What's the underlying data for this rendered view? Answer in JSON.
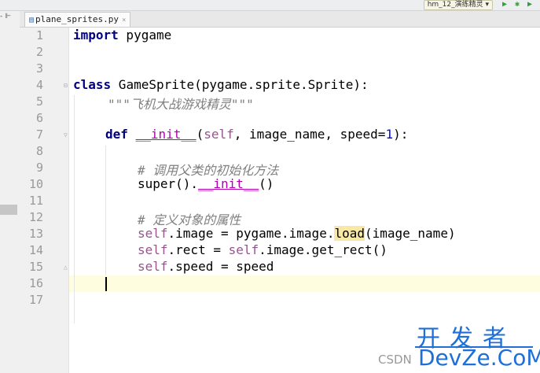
{
  "toolbar": {
    "run_config": "hm_12_演练精灵 ▾"
  },
  "tab": {
    "filename": "plane_sprites.py",
    "close": "×"
  },
  "left_strip": {
    "mini": "- ⊩"
  },
  "line_numbers": [
    "1",
    "2",
    "3",
    "4",
    "5",
    "6",
    "7",
    "8",
    "9",
    "10",
    "11",
    "12",
    "13",
    "14",
    "15",
    "16",
    "17"
  ],
  "code": {
    "l1_kw": "import",
    "l1_rest": " pygame",
    "l4_kw": "class",
    "l4_rest": " GameSprite(pygame.sprite.Sprite):",
    "l5_doc": "\"\"\"飞机大战游戏精灵\"\"\"",
    "l7_kw": "def",
    "l7_sp": " ",
    "l7_init": "__init__",
    "l7_a": "(",
    "l7_self": "self",
    "l7_b": ", image_name, speed=",
    "l7_num": "1",
    "l7_c": "):",
    "l9_comment": "# 调用父类的初始化方法",
    "l10_a": "super().",
    "l10_init": "__init__",
    "l10_b": "()",
    "l12_comment": "# 定义对象的属性",
    "l13_self": "self",
    "l13_a": ".image = pygame.image.",
    "l13_load": "load",
    "l13_b": "(image_name)",
    "l14_self1": "self",
    "l14_a": ".rect = ",
    "l14_self2": "self",
    "l14_b": ".image.get_rect()",
    "l15_self": "self",
    "l15_a": ".speed = speed"
  },
  "watermark": {
    "cn": "开发者",
    "csdn": "CSDN",
    "en": "DevZe.CoM"
  },
  "colors": {
    "keyword": "#000080",
    "self": "#94558d",
    "number": "#0000ff",
    "magic": "#b200b2",
    "comment": "#808080",
    "watermark": "#1e6fd8"
  }
}
